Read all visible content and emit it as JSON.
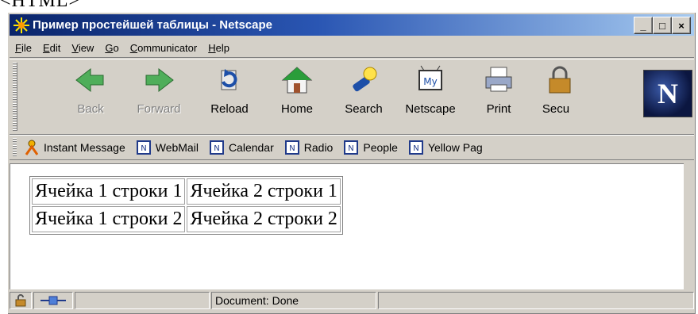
{
  "top_fragment": "<HTML>",
  "window": {
    "title": "Пример простейшей таблицы - Netscape"
  },
  "window_controls": {
    "minimize": "_",
    "maximize": "□",
    "close": "×"
  },
  "menu": [
    {
      "first": "F",
      "rest": "ile"
    },
    {
      "first": "E",
      "rest": "dit"
    },
    {
      "first": "V",
      "rest": "iew"
    },
    {
      "first": "G",
      "rest": "o"
    },
    {
      "first": "C",
      "rest": "ommunicator"
    },
    {
      "first": "H",
      "rest": "elp"
    }
  ],
  "toolbar": {
    "back": "Back",
    "forward": "Forward",
    "reload": "Reload",
    "home": "Home",
    "search": "Search",
    "netscape": "Netscape",
    "netscape_icon_text": "My",
    "print": "Print",
    "security": "Secu"
  },
  "logo": "N",
  "personal_bar": {
    "instant_message": "Instant Message",
    "webmail": "WebMail",
    "calendar": "Calendar",
    "radio": "Radio",
    "people": "People",
    "yellow_pages": "Yellow Pag"
  },
  "table": {
    "rows": [
      [
        "Ячейка 1 строки 1",
        "Ячейка 2 строки 1"
      ],
      [
        "Ячейка 1 строки 2",
        "Ячейка 2 строки 2"
      ]
    ]
  },
  "status": {
    "text": "Document: Done"
  },
  "colors": {
    "titlebar_start": "#0a246a",
    "titlebar_end": "#a6caf0",
    "chrome": "#d4d0c8"
  },
  "icons": [
    "netscape-star-icon",
    "back-arrow-icon",
    "forward-arrow-icon",
    "reload-icon",
    "home-icon",
    "search-flashlight-icon",
    "my-netscape-icon",
    "printer-icon",
    "security-lock-icon",
    "netscape-n-logo",
    "instant-message-person-icon",
    "bookmark-page-icon",
    "padlock-icon",
    "connection-icon"
  ]
}
